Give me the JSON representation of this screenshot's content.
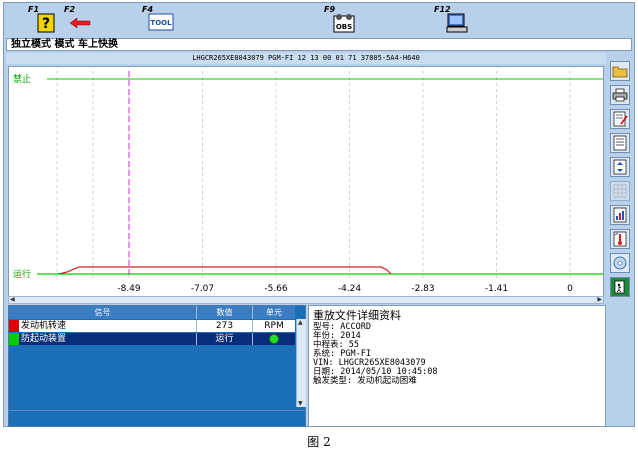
{
  "toolbar": {
    "f1": "F1",
    "f2": "F2",
    "f4": "F4",
    "f4_icon_text": "TOOL",
    "f9": "F9",
    "f9_icon_text": "OBS",
    "f12": "F12"
  },
  "mode_bar": "独立模式 模式 车上快换",
  "info_bar": "LHGCR265XE8043079  PGM-FI  12 13 00 01 71  37805-5A4-H640",
  "graph": {
    "label_top": "禁止",
    "label_bottom": "运行",
    "ticks": [
      "-8.49",
      "-7.07",
      "-5.66",
      "-4.24",
      "-2.83",
      "-1.41",
      "0"
    ],
    "colors": {
      "grid": "#bfbfbf",
      "cursor": "#e020e0",
      "label": "#00aa00",
      "trace_green": "#00cc00",
      "trace_red": "#d02020"
    }
  },
  "signal_table": {
    "headers": [
      "信号",
      "数值",
      "单元"
    ],
    "rows": [
      {
        "name": "发动机转速",
        "value": "273",
        "unit": "RPM",
        "color": "#e00000"
      },
      {
        "name": "防起动装置",
        "value": "运行",
        "unit": "",
        "color": "#00cc00"
      }
    ]
  },
  "details": {
    "title": "重放文件详细资料",
    "lines": [
      "型号: ACCORD",
      "年份: 2014",
      "中程表:  55",
      "系统: PGM-FI",
      "VIN: LHGCR265XE8043079",
      "日期: 2014/05/10 10:45:08",
      "触发类型: 发动机起动困难"
    ]
  },
  "caption": "图 2"
}
